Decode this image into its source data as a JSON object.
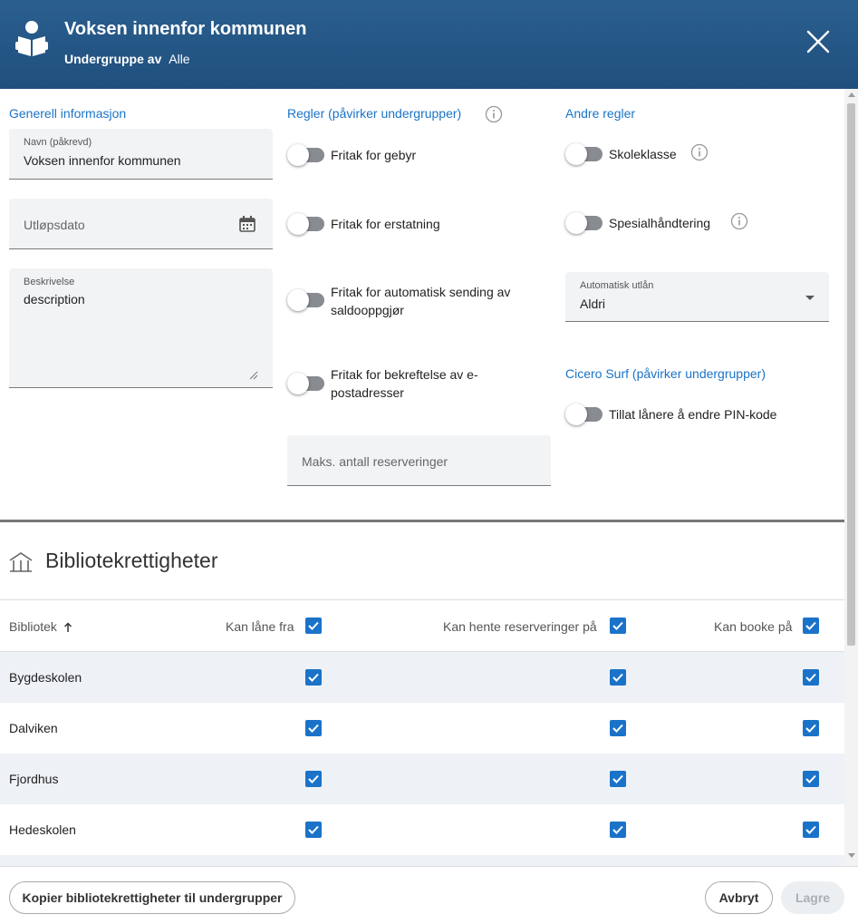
{
  "header": {
    "title": "Voksen innenfor kommunen",
    "subtitle_prefix": "Undergruppe av",
    "subtitle_value": "Alle"
  },
  "general": {
    "section_title": "Generell informasjon",
    "name_label": "Navn (påkrevd)",
    "name_value": "Voksen innenfor kommunen",
    "expiry_placeholder": "Utløpsdato",
    "description_label": "Beskrivelse",
    "description_value": "description"
  },
  "rules": {
    "section_title": "Regler (påvirker undergrupper)",
    "toggles": [
      {
        "label": "Fritak for gebyr",
        "on": false
      },
      {
        "label": "Fritak for erstatning",
        "on": false
      },
      {
        "label": "Fritak for automatisk sending av saldooppgjør",
        "on": false
      },
      {
        "label": "Fritak for bekreftelse av e-postadresser",
        "on": false
      }
    ],
    "max_reservations_placeholder": "Maks. antall reserveringer"
  },
  "other_rules": {
    "section_title": "Andre regler",
    "toggles": [
      {
        "label": "Skoleklasse",
        "on": false
      },
      {
        "label": "Spesialhåndtering",
        "on": false
      }
    ],
    "auto_loan_label": "Automatisk utlån",
    "auto_loan_value": "Aldri"
  },
  "cicero": {
    "section_title": "Cicero Surf (påvirker undergrupper)",
    "toggle_label": "Tillat lånere å endre PIN-kode",
    "toggle_on": false
  },
  "library_rights": {
    "title": "Bibliotekrettigheter",
    "columns": {
      "library": "Bibliotek",
      "can_borrow": "Kan låne fra",
      "can_pickup": "Kan hente reserveringer på",
      "can_book": "Kan booke på"
    },
    "rows": [
      {
        "name": "Bygdeskolen",
        "can_borrow": true,
        "can_pickup": true,
        "can_book": true
      },
      {
        "name": "Dalviken",
        "can_borrow": true,
        "can_pickup": true,
        "can_book": true
      },
      {
        "name": "Fjordhus",
        "can_borrow": true,
        "can_pickup": true,
        "can_book": true
      },
      {
        "name": "Hedeskolen",
        "can_borrow": true,
        "can_pickup": true,
        "can_book": true
      }
    ]
  },
  "footer": {
    "copy_button": "Kopier bibliotekrettigheter til undergrupper",
    "cancel_button": "Avbryt",
    "save_button": "Lagre"
  },
  "colors": {
    "header_bg": "#1f4f7d",
    "accent": "#1a73c8",
    "row_alt": "#eef2f6"
  }
}
